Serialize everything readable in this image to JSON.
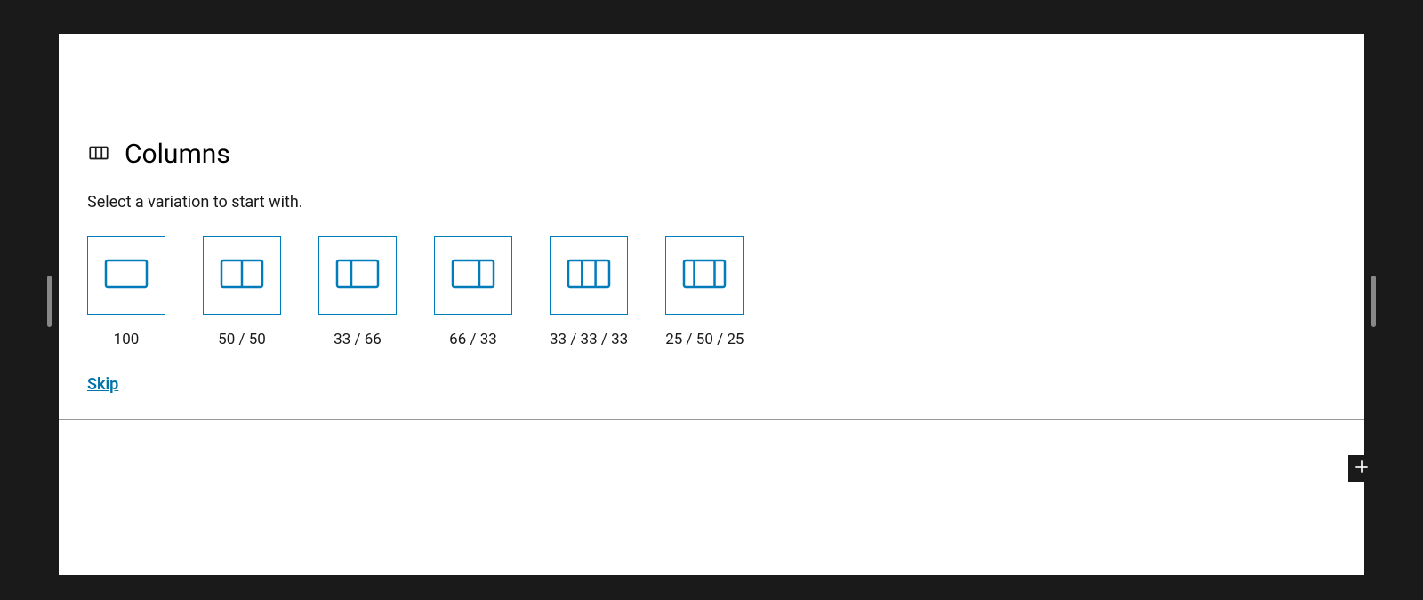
{
  "panel": {
    "title": "Columns",
    "subtitle": "Select a variation to start with.",
    "skip_label": "Skip"
  },
  "variations": [
    {
      "label": "100"
    },
    {
      "label": "50 / 50"
    },
    {
      "label": "33 / 66"
    },
    {
      "label": "66 / 33"
    },
    {
      "label": "33 / 33 / 33"
    },
    {
      "label": "25 / 50 / 25"
    }
  ]
}
